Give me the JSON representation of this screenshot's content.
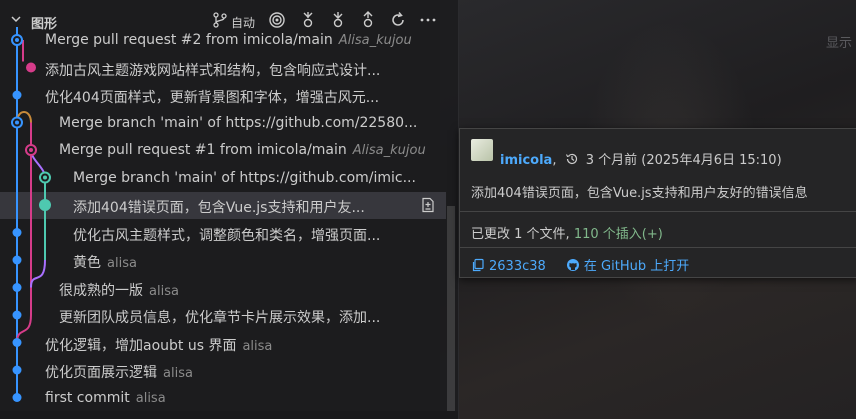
{
  "header": {
    "title": "图形",
    "auto_label": "自动",
    "tools": [
      "branch-icon",
      "target-icon",
      "fetch-icon",
      "pull-icon",
      "push-icon",
      "refresh-icon",
      "more-icon"
    ]
  },
  "ghost_hint": "显示",
  "commits": [
    {
      "message": "Merge pull request #2 from imicola/main",
      "author": "Alisa_kujou",
      "italic": true,
      "indent": 1
    },
    {
      "message": "添加古风主题游戏网站样式和结构，包含响应式设计...",
      "author": "",
      "indent": 1
    },
    {
      "message": "优化404页面样式，更新背景图和字体，增强古风元...",
      "author": "",
      "indent": 1
    },
    {
      "message": "Merge branch 'main' of https://github.com/22580...",
      "author": "",
      "indent": 2
    },
    {
      "message": "Merge pull request #1 from imicola/main",
      "author": "Alisa_kujou",
      "italic": true,
      "indent": 2
    },
    {
      "message": "Merge branch 'main' of https://github.com/imic...",
      "author": "",
      "indent": 3
    },
    {
      "message": "添加404错误页面，包含Vue.js支持和用户友...",
      "author": "",
      "indent": 3,
      "selected": true
    },
    {
      "message": "优化古风主题样式，调整颜色和类名，增强页面...",
      "author": "",
      "indent": 3
    },
    {
      "message": "黄色",
      "author": "alisa",
      "indent": 3
    },
    {
      "message": "很成熟的一版",
      "author": "alisa",
      "indent": 2
    },
    {
      "message": "更新团队成员信息，优化章节卡片展示效果，添加...",
      "author": "",
      "indent": 2
    },
    {
      "message": "优化逻辑，增加aoubt us 界面",
      "author": "alisa",
      "indent": 1
    },
    {
      "message": "优化页面展示逻辑",
      "author": "alisa",
      "indent": 1
    },
    {
      "message": "first commit",
      "author": "alisa",
      "indent": 1
    }
  ],
  "hover": {
    "name": "imicola",
    "sep": ",",
    "when": "3 个月前 (2025年4月6日 15:10)",
    "body": "添加404错误页面，包含Vue.js支持和用户友好的错误信息",
    "changes_prefix": "已更改 1 个文件,",
    "insertions": "110 个插入(+)",
    "hash": "2633c38",
    "github_link": "在 GitHub 上打开"
  },
  "colors": {
    "lane_blue": "#3794ff",
    "lane_pink": "#d63c8a",
    "lane_teal": "#4ec9b0",
    "lane_orange": "#c88a3a",
    "lane_purple": "#a970ff",
    "link": "#4daafc",
    "insert_green": "#81b88b"
  }
}
